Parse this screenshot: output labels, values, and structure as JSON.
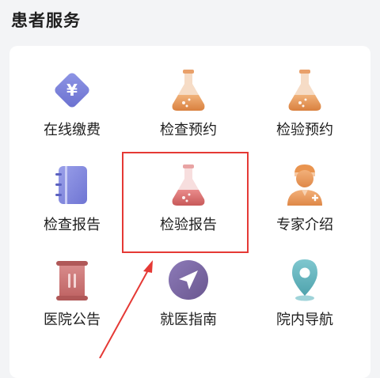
{
  "section": {
    "title": "患者服务"
  },
  "colors": {
    "highlight": "#e53935"
  },
  "services": [
    {
      "label": "在线缴费",
      "icon": "payment-icon"
    },
    {
      "label": "检查预约",
      "icon": "flask-icon"
    },
    {
      "label": "检验预约",
      "icon": "flask-icon"
    },
    {
      "label": "检查报告",
      "icon": "notebook-icon"
    },
    {
      "label": "检验报告",
      "icon": "flask-icon"
    },
    {
      "label": "专家介绍",
      "icon": "doctor-icon"
    },
    {
      "label": "医院公告",
      "icon": "scroll-icon"
    },
    {
      "label": "就医指南",
      "icon": "navigation-arrow-icon"
    },
    {
      "label": "院内导航",
      "icon": "map-pin-icon"
    }
  ]
}
